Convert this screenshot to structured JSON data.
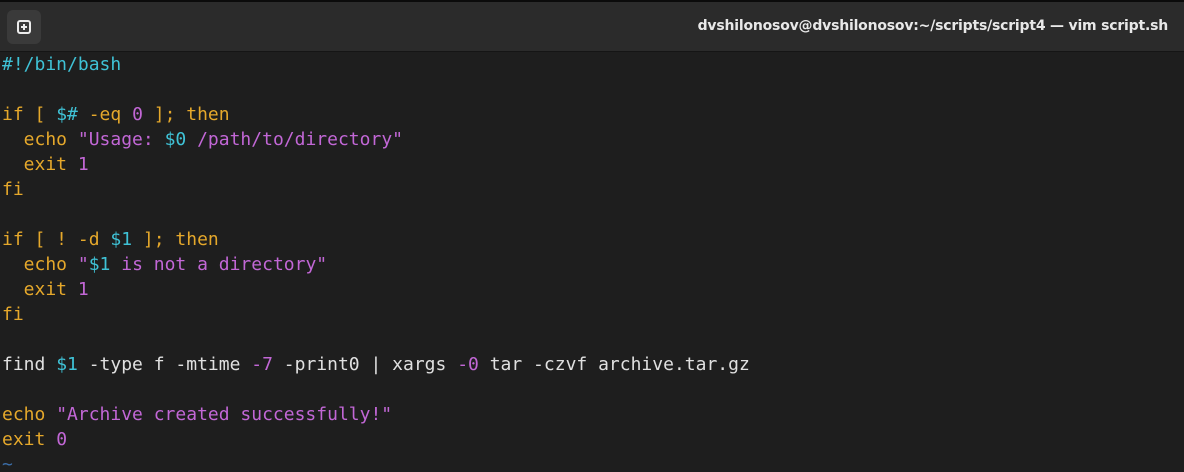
{
  "window": {
    "title": "dvshilonosov@dvshilonosov:~/scripts/script4 — vim script.sh",
    "new_tab_icon": "new-tab-icon"
  },
  "colors": {
    "default": "#e0e0e0",
    "shebang": "#3fc2d6",
    "keyword": "#e5a82b",
    "string": "#c267d6",
    "variable": "#3fc2d6",
    "number": "#c267d6",
    "tilde": "#3b6ea8"
  },
  "code_lines": [
    [
      {
        "t": "#!/bin/bash",
        "c": "shebang"
      }
    ],
    [],
    [
      {
        "t": "if [ ",
        "c": "keyword"
      },
      {
        "t": "$#",
        "c": "variable"
      },
      {
        "t": " -eq ",
        "c": "keyword"
      },
      {
        "t": "0",
        "c": "number"
      },
      {
        "t": " ]; then",
        "c": "keyword"
      }
    ],
    [
      {
        "t": "  echo ",
        "c": "keyword"
      },
      {
        "t": "\"Usage: ",
        "c": "string"
      },
      {
        "t": "$0",
        "c": "variable"
      },
      {
        "t": " /path/to/directory\"",
        "c": "string"
      }
    ],
    [
      {
        "t": "  exit ",
        "c": "keyword"
      },
      {
        "t": "1",
        "c": "number"
      }
    ],
    [
      {
        "t": "fi",
        "c": "keyword"
      }
    ],
    [],
    [
      {
        "t": "if [ ! -d ",
        "c": "keyword"
      },
      {
        "t": "$1",
        "c": "variable"
      },
      {
        "t": " ]; then",
        "c": "keyword"
      }
    ],
    [
      {
        "t": "  echo ",
        "c": "keyword"
      },
      {
        "t": "\"",
        "c": "string"
      },
      {
        "t": "$1",
        "c": "variable"
      },
      {
        "t": " is not a directory\"",
        "c": "string"
      }
    ],
    [
      {
        "t": "  exit ",
        "c": "keyword"
      },
      {
        "t": "1",
        "c": "number"
      }
    ],
    [
      {
        "t": "fi",
        "c": "keyword"
      }
    ],
    [],
    [
      {
        "t": "find ",
        "c": "default"
      },
      {
        "t": "$1",
        "c": "variable"
      },
      {
        "t": " -type f -mtime ",
        "c": "default"
      },
      {
        "t": "-7",
        "c": "number"
      },
      {
        "t": " -print0 | xargs ",
        "c": "default"
      },
      {
        "t": "-0",
        "c": "number"
      },
      {
        "t": " tar -czvf archive.tar.gz",
        "c": "default"
      }
    ],
    [],
    [
      {
        "t": "echo ",
        "c": "keyword"
      },
      {
        "t": "\"Archive created successfully!\"",
        "c": "string"
      }
    ],
    [
      {
        "t": "exit ",
        "c": "keyword"
      },
      {
        "t": "0",
        "c": "number"
      }
    ],
    [
      {
        "t": "~",
        "c": "tilde"
      }
    ]
  ]
}
